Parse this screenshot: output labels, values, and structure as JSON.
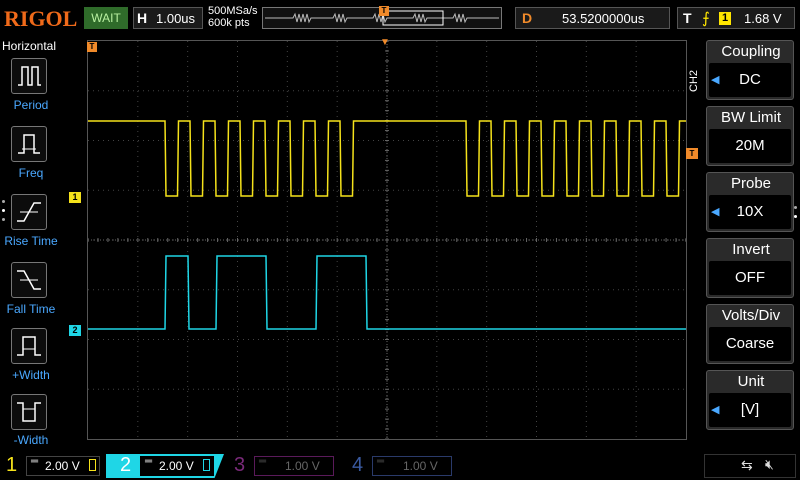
{
  "header": {
    "brand": "RIGOL",
    "run_state": "WAIT",
    "timebase": {
      "key": "H",
      "value": "1.00us"
    },
    "sample_rate": "500MSa/s",
    "memory_depth": "600k pts",
    "delay": {
      "key": "D",
      "value": "53.5200000us"
    },
    "trigger": {
      "key": "T",
      "edge_symbol": "⨍",
      "source": "1",
      "level": "1.68 V"
    }
  },
  "left_menu": {
    "title": "Horizontal",
    "items": [
      {
        "label": "Period",
        "icon": "period-icon"
      },
      {
        "label": "Freq",
        "icon": "frequency-icon"
      },
      {
        "label": "Rise Time",
        "icon": "rise-time-icon"
      },
      {
        "label": "Fall Time",
        "icon": "fall-time-icon"
      },
      {
        "label": "+Width",
        "icon": "positive-width-icon"
      },
      {
        "label": "-Width",
        "icon": "negative-width-icon"
      }
    ]
  },
  "right_menu": {
    "channel_label": "CH2",
    "items": [
      {
        "title": "Coupling",
        "value": "DC"
      },
      {
        "title": "BW Limit",
        "value": "20M"
      },
      {
        "title": "Probe",
        "value": "10X"
      },
      {
        "title": "Invert",
        "value": "OFF"
      },
      {
        "title": "Volts/Div",
        "value": "Coarse"
      },
      {
        "title": "Unit",
        "value": "[V]"
      }
    ]
  },
  "markers": {
    "ch1": "1",
    "ch2": "2",
    "trigger_marker": "T"
  },
  "channels": [
    {
      "num": "1",
      "scale": "2.00 V",
      "color": "#f5e21b",
      "active": true
    },
    {
      "num": "2",
      "scale": "2.00 V",
      "color": "#1fd6e6",
      "active": true
    },
    {
      "num": "3",
      "scale": "1.00 V",
      "color": "#a020a0",
      "active": false
    },
    {
      "num": "4",
      "scale": "1.00 V",
      "color": "#3a5aa0",
      "active": false
    }
  ],
  "status_icons": [
    "usb-icon",
    "mute-icon"
  ],
  "colors": {
    "ch1": "#f5e21b",
    "ch2": "#1fd6e6",
    "accent": "#f08a2a",
    "menu_blue": "#4aa8ff"
  }
}
